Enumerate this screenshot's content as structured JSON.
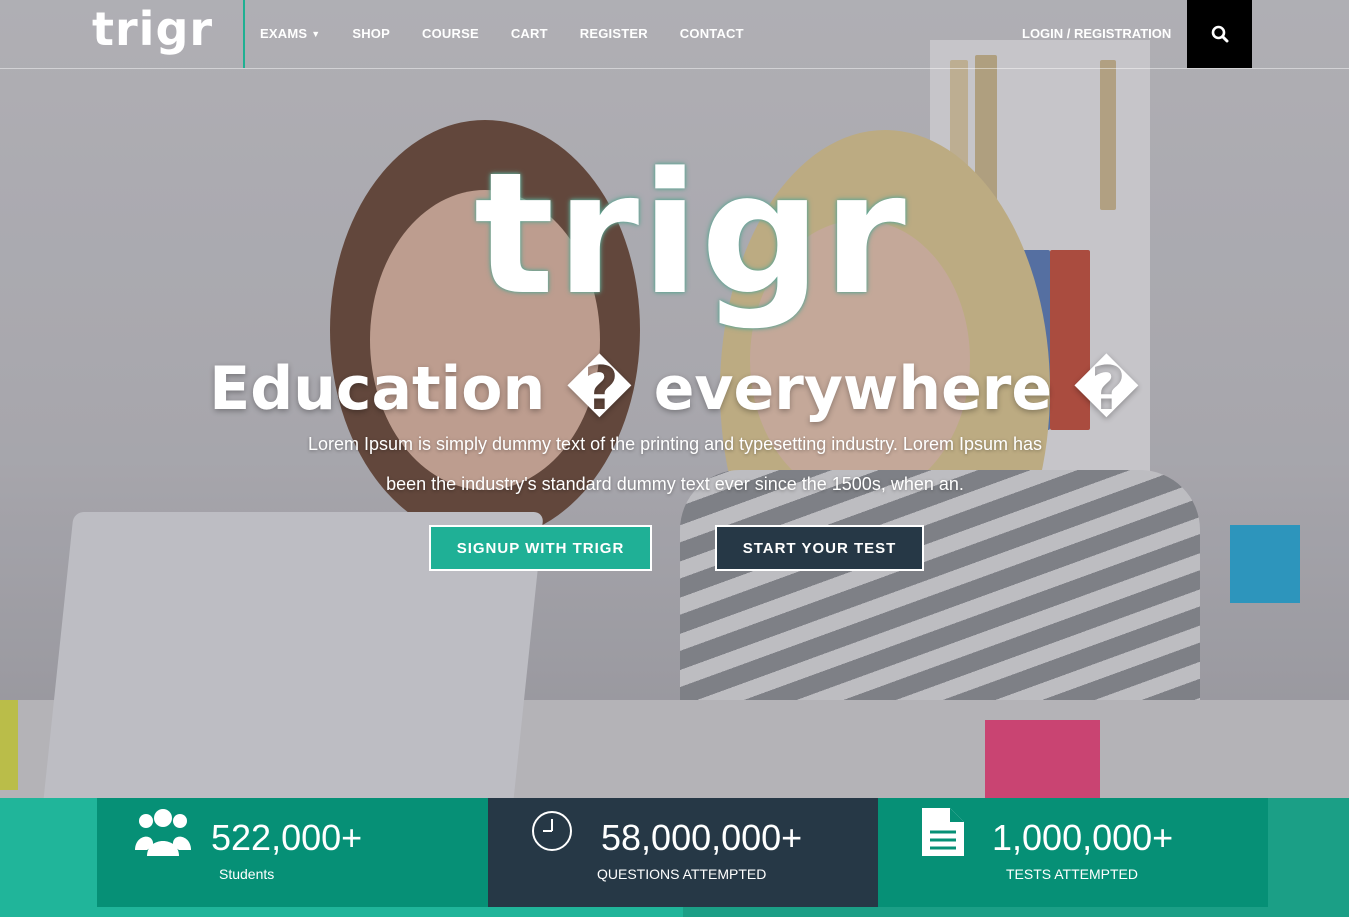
{
  "nav": {
    "logo": "trigr",
    "menu": [
      {
        "label": "EXAMS",
        "has_dropdown": true
      },
      {
        "label": "SHOP",
        "has_dropdown": false
      },
      {
        "label": "COURSE",
        "has_dropdown": false
      },
      {
        "label": "CART",
        "has_dropdown": false
      },
      {
        "label": "REGISTER",
        "has_dropdown": false
      },
      {
        "label": "CONTACT",
        "has_dropdown": false
      }
    ],
    "login": "LOGIN / REGISTRATION",
    "search_icon": "search-icon"
  },
  "hero": {
    "logo": "trigr",
    "headline": "Education � everywhere �",
    "lead": "Lorem Ipsum is simply dummy text of the printing and typesetting industry. Lorem Ipsum has been the industry's standard dummy text ever since the 1500s, when an.",
    "signup_button": "SIGNUP WITH TRIGR",
    "test_button": "START YOUR TEST"
  },
  "stats": [
    {
      "icon": "users-icon",
      "value": "522,000+",
      "label": "Students"
    },
    {
      "icon": "clock-icon",
      "value": "58,000,000+",
      "label": "QUESTIONS ATTEMPTED"
    },
    {
      "icon": "document-icon",
      "value": "1,000,000+",
      "label": "TESTS ATTEMPTED"
    }
  ],
  "colors": {
    "teal": "#1fb096",
    "dark_teal": "#069076",
    "navy": "#263846",
    "black": "#000000"
  }
}
